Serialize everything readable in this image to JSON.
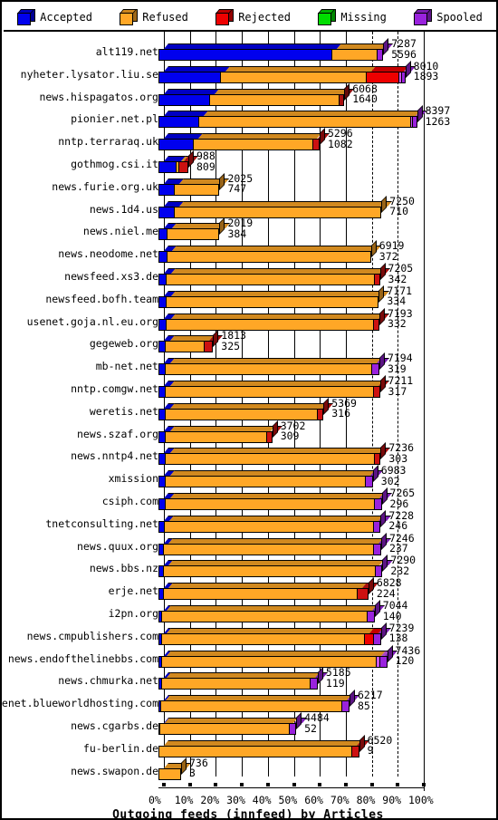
{
  "legend": {
    "items": [
      {
        "label": "Accepted",
        "color": "#0000ee",
        "icon": "cube-icon"
      },
      {
        "label": "Refused",
        "color": "#ffa726",
        "icon": "cube-icon"
      },
      {
        "label": "Rejected",
        "color": "#ee0000",
        "icon": "cube-icon"
      },
      {
        "label": "Missing",
        "color": "#00dd00",
        "icon": "cube-icon"
      },
      {
        "label": "Spooled",
        "color": "#9922dd",
        "icon": "cube-icon"
      }
    ]
  },
  "axis": {
    "title": "Outgoing feeds (innfeed) by Articles",
    "xticks": [
      "0%",
      "10%",
      "20%",
      "30%",
      "40%",
      "50%",
      "60%",
      "70%",
      "80%",
      "90%",
      "100%"
    ],
    "xmin": 0,
    "xmax": 100
  },
  "chart_data": {
    "type": "bar",
    "orientation": "horizontal",
    "stacked": true,
    "title": "Outgoing feeds (innfeed) by Articles",
    "xlabel": "Outgoing feeds (innfeed) by Articles",
    "ylabel": "",
    "xlim": [
      0,
      100
    ],
    "xunit": "percent",
    "grid": "vertical-dashed-and-solid",
    "legend_position": "top",
    "series_names": [
      "Accepted",
      "Refused",
      "Rejected",
      "Missing",
      "Spooled"
    ],
    "series_colors": [
      "#0000ee",
      "#ffa726",
      "#ee0000",
      "#00dd00",
      "#9922dd"
    ],
    "categories": [
      "alt119.net",
      "nyheter.lysator.liu.se",
      "news.hispagatos.org",
      "pionier.net.pl",
      "nntp.terraraq.uk",
      "gothmog.csi.it",
      "news.furie.org.uk",
      "news.1d4.us",
      "news.niel.me",
      "news.neodome.net",
      "newsfeed.xs3.de",
      "newsfeed.bofh.team",
      "usenet.goja.nl.eu.org",
      "gegeweb.org",
      "mb-net.net",
      "nntp.comgw.net",
      "weretis.net",
      "news.szaf.org",
      "news.nntp4.net",
      "xmission",
      "csiph.com",
      "tnetconsulting.net",
      "news.quux.org",
      "news.bbs.nz",
      "erje.net",
      "i2pn.org",
      "news.cmpublishers.com",
      "news.endofthelinebbs.com",
      "news.chmurka.net",
      "usenet.blueworldhosting.com",
      "news.cgarbs.de",
      "fu-berlin.de",
      "news.swapon.de"
    ],
    "rows": [
      {
        "name": "alt119.net",
        "total": 7287,
        "accepted": 5596,
        "pct_total": 86.5,
        "segments": [
          {
            "s": "Accepted",
            "pct": 66.4,
            "color": "#0000ee"
          },
          {
            "s": "Refused",
            "pct": 17.5,
            "color": "#ffa726"
          },
          {
            "s": "Spooled",
            "pct": 2.6,
            "color": "#9922dd"
          }
        ]
      },
      {
        "name": "nyheter.lysator.liu.se",
        "total": 8010,
        "accepted": 1893,
        "pct_total": 95.0,
        "segments": [
          {
            "s": "Accepted",
            "pct": 23.6,
            "color": "#0000ee"
          },
          {
            "s": "Refused",
            "pct": 56.1,
            "color": "#ffa726"
          },
          {
            "s": "Rejected",
            "pct": 12.6,
            "color": "#ee0000"
          },
          {
            "s": "Missing",
            "pct": 1.0,
            "color": "#cc55ee"
          },
          {
            "s": "Spooled",
            "pct": 1.7,
            "color": "#9922dd"
          }
        ]
      },
      {
        "name": "news.hispagatos.org",
        "total": 6068,
        "accepted": 1640,
        "pct_total": 71.5,
        "segments": [
          {
            "s": "Accepted",
            "pct": 19.5,
            "color": "#0000ee"
          },
          {
            "s": "Refused",
            "pct": 50.0,
            "color": "#ffa726"
          },
          {
            "s": "Rejected",
            "pct": 2.0,
            "color": "#aa1111"
          }
        ]
      },
      {
        "name": "pionier.net.pl",
        "total": 8397,
        "accepted": 1263,
        "pct_total": 99.5,
        "segments": [
          {
            "s": "Accepted",
            "pct": 15.4,
            "color": "#0000ee"
          },
          {
            "s": "Refused",
            "pct": 81.6,
            "color": "#ffa726"
          },
          {
            "s": "Missing",
            "pct": 0.7,
            "color": "#cc55ee"
          },
          {
            "s": "Spooled",
            "pct": 1.8,
            "color": "#9922dd"
          }
        ]
      },
      {
        "name": "nntp.terraraq.uk",
        "total": 5296,
        "accepted": 1082,
        "pct_total": 62.0,
        "segments": [
          {
            "s": "Accepted",
            "pct": 13.3,
            "color": "#0000ee"
          },
          {
            "s": "Refused",
            "pct": 45.8,
            "color": "#ffa726"
          },
          {
            "s": "Rejected",
            "pct": 2.9,
            "color": "#cc1111"
          }
        ]
      },
      {
        "name": "gothmog.csi.it",
        "total": 988,
        "accepted": 809,
        "pct_total": 11.5,
        "segments": [
          {
            "s": "Accepted",
            "pct": 6.6,
            "color": "#0000ee"
          },
          {
            "s": "Refused",
            "pct": 1.2,
            "color": "#ffa726"
          },
          {
            "s": "Rejected",
            "pct": 3.7,
            "color": "#cc1111"
          }
        ]
      },
      {
        "name": "news.furie.org.uk",
        "total": 2025,
        "accepted": 747,
        "pct_total": 23.5,
        "segments": [
          {
            "s": "Accepted",
            "pct": 6.0,
            "color": "#0000ee"
          },
          {
            "s": "Refused",
            "pct": 17.5,
            "color": "#ffa726"
          }
        ]
      },
      {
        "name": "news.1d4.us",
        "total": 7250,
        "accepted": 710,
        "pct_total": 85.8,
        "segments": [
          {
            "s": "Accepted",
            "pct": 5.8,
            "color": "#0000ee"
          },
          {
            "s": "Refused",
            "pct": 80.0,
            "color": "#ffa726"
          }
        ]
      },
      {
        "name": "news.niel.me",
        "total": 2019,
        "accepted": 384,
        "pct_total": 23.5,
        "segments": [
          {
            "s": "Accepted",
            "pct": 3.1,
            "color": "#0000ee"
          },
          {
            "s": "Refused",
            "pct": 20.4,
            "color": "#ffa726"
          }
        ]
      },
      {
        "name": "news.neodome.net",
        "total": 6919,
        "accepted": 372,
        "pct_total": 81.8,
        "segments": [
          {
            "s": "Accepted",
            "pct": 3.0,
            "color": "#0000ee"
          },
          {
            "s": "Refused",
            "pct": 78.8,
            "color": "#ffa726"
          }
        ]
      },
      {
        "name": "newsfeed.xs3.de",
        "total": 7205,
        "accepted": 342,
        "pct_total": 85.2,
        "segments": [
          {
            "s": "Accepted",
            "pct": 2.8,
            "color": "#0000ee"
          },
          {
            "s": "Refused",
            "pct": 80.0,
            "color": "#ffa726"
          },
          {
            "s": "Rejected",
            "pct": 2.4,
            "color": "#cc1111"
          }
        ]
      },
      {
        "name": "newsfeed.bofh.team",
        "total": 7171,
        "accepted": 334,
        "pct_total": 84.8,
        "segments": [
          {
            "s": "Accepted",
            "pct": 2.7,
            "color": "#0000ee"
          },
          {
            "s": "Refused",
            "pct": 82.1,
            "color": "#ffa726"
          }
        ]
      },
      {
        "name": "usenet.goja.nl.eu.org",
        "total": 7193,
        "accepted": 332,
        "pct_total": 85.0,
        "segments": [
          {
            "s": "Accepted",
            "pct": 2.7,
            "color": "#0000ee"
          },
          {
            "s": "Refused",
            "pct": 79.9,
            "color": "#ffa726"
          },
          {
            "s": "Rejected",
            "pct": 2.4,
            "color": "#cc1111"
          }
        ]
      },
      {
        "name": "gegeweb.org",
        "total": 1813,
        "accepted": 325,
        "pct_total": 21.0,
        "segments": [
          {
            "s": "Accepted",
            "pct": 2.6,
            "color": "#0000ee"
          },
          {
            "s": "Refused",
            "pct": 14.9,
            "color": "#ffa726"
          },
          {
            "s": "Rejected",
            "pct": 3.5,
            "color": "#cc1111"
          }
        ]
      },
      {
        "name": "mb-net.net",
        "total": 7194,
        "accepted": 319,
        "pct_total": 85.0,
        "segments": [
          {
            "s": "Accepted",
            "pct": 2.6,
            "color": "#0000ee"
          },
          {
            "s": "Refused",
            "pct": 79.4,
            "color": "#ffa726"
          },
          {
            "s": "Spooled",
            "pct": 3.0,
            "color": "#9922dd"
          }
        ]
      },
      {
        "name": "nntp.comgw.net",
        "total": 7211,
        "accepted": 317,
        "pct_total": 85.2,
        "segments": [
          {
            "s": "Accepted",
            "pct": 2.6,
            "color": "#0000ee"
          },
          {
            "s": "Refused",
            "pct": 80.1,
            "color": "#ffa726"
          },
          {
            "s": "Rejected",
            "pct": 2.5,
            "color": "#cc1111"
          }
        ]
      },
      {
        "name": "weretis.net",
        "total": 5369,
        "accepted": 316,
        "pct_total": 63.5,
        "segments": [
          {
            "s": "Accepted",
            "pct": 2.6,
            "color": "#0000ee"
          },
          {
            "s": "Refused",
            "pct": 58.4,
            "color": "#ffa726"
          },
          {
            "s": "Rejected",
            "pct": 2.5,
            "color": "#cc1111"
          }
        ]
      },
      {
        "name": "news.szaf.org",
        "total": 3702,
        "accepted": 309,
        "pct_total": 43.8,
        "segments": [
          {
            "s": "Accepted",
            "pct": 2.5,
            "color": "#0000ee"
          },
          {
            "s": "Refused",
            "pct": 38.8,
            "color": "#ffa726"
          },
          {
            "s": "Rejected",
            "pct": 2.5,
            "color": "#cc1111"
          }
        ]
      },
      {
        "name": "news.nntp4.net",
        "total": 7236,
        "accepted": 303,
        "pct_total": 85.5,
        "segments": [
          {
            "s": "Accepted",
            "pct": 2.5,
            "color": "#0000ee"
          },
          {
            "s": "Refused",
            "pct": 80.5,
            "color": "#ffa726"
          },
          {
            "s": "Rejected",
            "pct": 2.5,
            "color": "#cc1111"
          }
        ]
      },
      {
        "name": "xmission",
        "total": 6983,
        "accepted": 302,
        "pct_total": 82.5,
        "segments": [
          {
            "s": "Accepted",
            "pct": 2.4,
            "color": "#0000ee"
          },
          {
            "s": "Refused",
            "pct": 77.1,
            "color": "#ffa726"
          },
          {
            "s": "Spooled",
            "pct": 3.0,
            "color": "#9922dd"
          }
        ]
      },
      {
        "name": "csiph.com",
        "total": 7265,
        "accepted": 296,
        "pct_total": 85.9,
        "segments": [
          {
            "s": "Accepted",
            "pct": 2.4,
            "color": "#0000ee"
          },
          {
            "s": "Refused",
            "pct": 80.5,
            "color": "#ffa726"
          },
          {
            "s": "Spooled",
            "pct": 3.0,
            "color": "#9922dd"
          }
        ]
      },
      {
        "name": "tnetconsulting.net",
        "total": 7228,
        "accepted": 246,
        "pct_total": 85.5,
        "segments": [
          {
            "s": "Accepted",
            "pct": 2.0,
            "color": "#0000ee"
          },
          {
            "s": "Refused",
            "pct": 80.5,
            "color": "#ffa726"
          },
          {
            "s": "Spooled",
            "pct": 3.0,
            "color": "#9922dd"
          }
        ]
      },
      {
        "name": "news.quux.org",
        "total": 7246,
        "accepted": 237,
        "pct_total": 85.7,
        "segments": [
          {
            "s": "Accepted",
            "pct": 1.9,
            "color": "#0000ee"
          },
          {
            "s": "Refused",
            "pct": 80.8,
            "color": "#ffa726"
          },
          {
            "s": "Spooled",
            "pct": 3.0,
            "color": "#9922dd"
          }
        ]
      },
      {
        "name": "news.bbs.nz",
        "total": 7290,
        "accepted": 232,
        "pct_total": 86.2,
        "segments": [
          {
            "s": "Accepted",
            "pct": 1.9,
            "color": "#0000ee"
          },
          {
            "s": "Refused",
            "pct": 81.3,
            "color": "#ffa726"
          },
          {
            "s": "Spooled",
            "pct": 3.0,
            "color": "#9922dd"
          }
        ]
      },
      {
        "name": "erje.net",
        "total": 6828,
        "accepted": 224,
        "pct_total": 80.8,
        "segments": [
          {
            "s": "Accepted",
            "pct": 1.8,
            "color": "#0000ee"
          },
          {
            "s": "Refused",
            "pct": 74.5,
            "color": "#ffa726"
          },
          {
            "s": "Rejected",
            "pct": 4.5,
            "color": "#cc1111"
          }
        ]
      },
      {
        "name": "i2pn.org",
        "total": 7044,
        "accepted": 140,
        "pct_total": 83.2,
        "segments": [
          {
            "s": "Accepted",
            "pct": 1.1,
            "color": "#0000ee"
          },
          {
            "s": "Refused",
            "pct": 79.1,
            "color": "#ffa726"
          },
          {
            "s": "Spooled",
            "pct": 3.0,
            "color": "#9922dd"
          }
        ]
      },
      {
        "name": "news.cmpublishers.com",
        "total": 7239,
        "accepted": 138,
        "pct_total": 85.6,
        "segments": [
          {
            "s": "Accepted",
            "pct": 1.1,
            "color": "#0000ee"
          },
          {
            "s": "Refused",
            "pct": 78.0,
            "color": "#ffa726"
          },
          {
            "s": "Rejected",
            "pct": 3.5,
            "color": "#ee0000"
          },
          {
            "s": "Spooled",
            "pct": 3.0,
            "color": "#9922dd"
          }
        ]
      },
      {
        "name": "news.endofthelinebbs.com",
        "total": 7436,
        "accepted": 120,
        "pct_total": 88.0,
        "segments": [
          {
            "s": "Accepted",
            "pct": 1.0,
            "color": "#0000ee"
          },
          {
            "s": "Refused",
            "pct": 82.5,
            "color": "#ffa726"
          },
          {
            "s": "Missing",
            "pct": 1.5,
            "color": "#cc55ee"
          },
          {
            "s": "Spooled",
            "pct": 3.0,
            "color": "#9922dd"
          }
        ]
      },
      {
        "name": "news.chmurka.net",
        "total": 5185,
        "accepted": 119,
        "pct_total": 61.3,
        "segments": [
          {
            "s": "Accepted",
            "pct": 1.0,
            "color": "#0000ee"
          },
          {
            "s": "Refused",
            "pct": 57.3,
            "color": "#ffa726"
          },
          {
            "s": "Spooled",
            "pct": 3.0,
            "color": "#9922dd"
          }
        ]
      },
      {
        "name": "usenet.blueworldhosting.com",
        "total": 6217,
        "accepted": 85,
        "pct_total": 73.5,
        "segments": [
          {
            "s": "Accepted",
            "pct": 0.7,
            "color": "#0000ee"
          },
          {
            "s": "Refused",
            "pct": 69.8,
            "color": "#ffa726"
          },
          {
            "s": "Spooled",
            "pct": 3.0,
            "color": "#9922dd"
          }
        ]
      },
      {
        "name": "news.cgarbs.de",
        "total": 4484,
        "accepted": 52,
        "pct_total": 53.0,
        "segments": [
          {
            "s": "Accepted",
            "pct": 0.4,
            "color": "#0000ee"
          },
          {
            "s": "Refused",
            "pct": 49.6,
            "color": "#ffa726"
          },
          {
            "s": "Spooled",
            "pct": 3.0,
            "color": "#9922dd"
          }
        ]
      },
      {
        "name": "fu-berlin.de",
        "total": 6520,
        "accepted": 9,
        "pct_total": 77.2,
        "segments": [
          {
            "s": "Refused",
            "pct": 74.2,
            "color": "#ffa726"
          },
          {
            "s": "Rejected",
            "pct": 3.0,
            "color": "#cc1111"
          }
        ]
      },
      {
        "name": "news.swapon.de",
        "total": 736,
        "accepted": 3,
        "pct_total": 8.7,
        "segments": [
          {
            "s": "Refused",
            "pct": 8.7,
            "color": "#ffa726"
          }
        ]
      }
    ]
  }
}
